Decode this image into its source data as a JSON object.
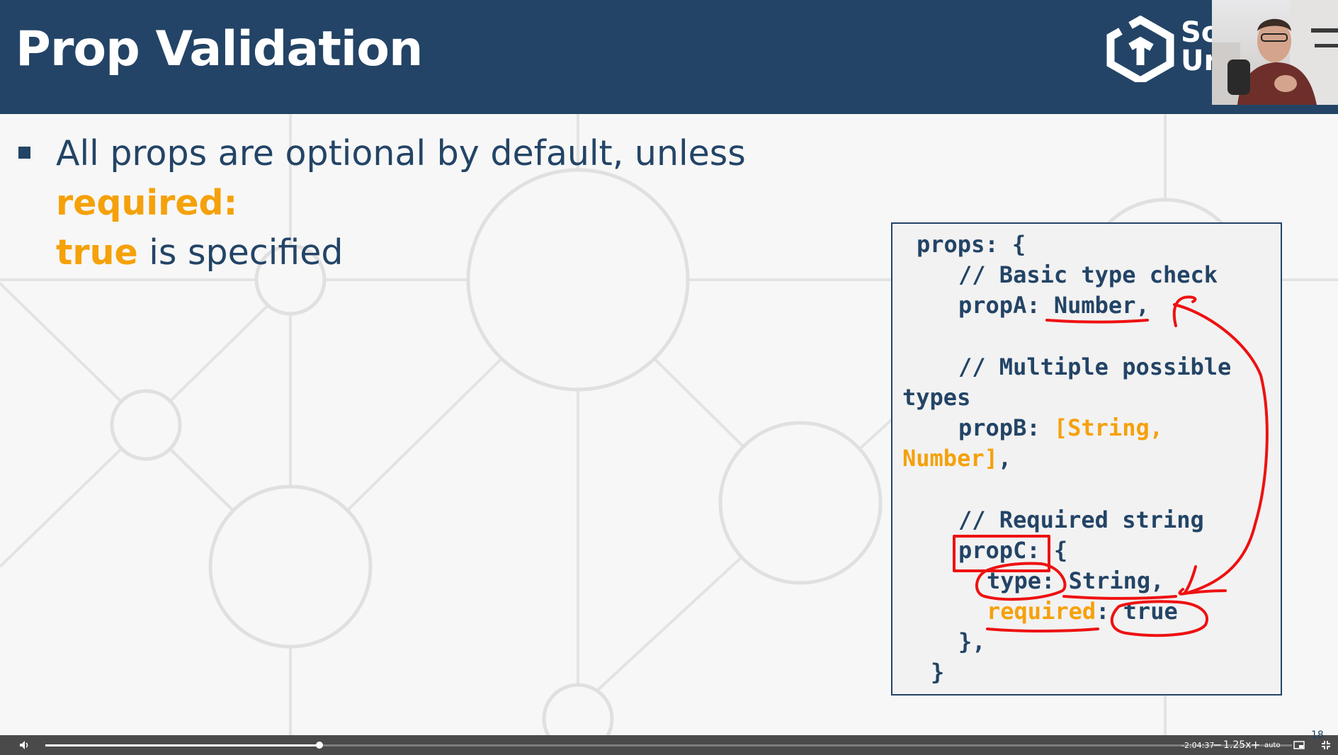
{
  "slide": {
    "title": "Prop Validation",
    "logo_text": "So Ur",
    "bullet_pre": "All props are optional by default, unless ",
    "bullet_hl1": "required:",
    "bullet_hl2": "true",
    "bullet_post": " is specified",
    "slide_number": "18"
  },
  "code": {
    "l1": "props: {",
    "l2": "// Basic type check",
    "l3a": "propA: ",
    "l3b": "Number,",
    "l4": "// Multiple possible",
    "l5": "types",
    "l6a": "propB: ",
    "l6b": "[String,",
    "l7a": "Number]",
    "l7b": ",",
    "l8": "// Required string",
    "l9": "propC: {",
    "l10": "type: String,",
    "l11a": "required",
    "l11b": ": true",
    "l12": "},",
    "l13": "}"
  },
  "player": {
    "time_remaining": "-2:04:37",
    "speed_minus": "−",
    "speed": "1.25x",
    "speed_plus": "+",
    "quality": "auto",
    "progress": 0.22
  },
  "colors": {
    "header": "#234466",
    "accent": "#f5a10a",
    "annotation": "#ee1111"
  },
  "icons": {
    "volume": "volume-icon",
    "pip": "picture-in-picture-icon",
    "fullscreen": "fullscreen-icon",
    "logo": "softuni-logo-icon"
  }
}
